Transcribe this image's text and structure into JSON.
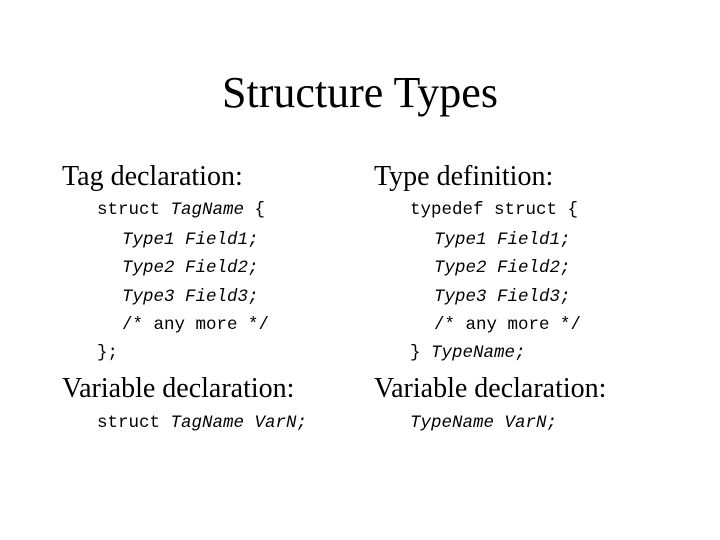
{
  "title": "Structure Types",
  "left": {
    "heading": "Tag declaration:",
    "code": {
      "line1_kw": "struct ",
      "line1_name": "TagName",
      "line1_end": " {",
      "field1": "Type1 Field1;",
      "field2": "Type2 Field2;",
      "field3": "Type3 Field3;",
      "comment": "/* any more */",
      "close": "};"
    },
    "var_heading": "Variable declaration:",
    "var_code": {
      "kw": "struct ",
      "tag": "TagName",
      "sep": " ",
      "var": "VarN;"
    }
  },
  "right": {
    "heading": "Type definition:",
    "code": {
      "line1": "typedef struct {",
      "field1": "Type1 Field1;",
      "field2": "Type2 Field2;",
      "field3": "Type3 Field3;",
      "comment": "/* any more */",
      "close_brace": "} ",
      "close_name": "TypeName;"
    },
    "var_heading": "Variable declaration:",
    "var_code": {
      "type": "TypeName",
      "sep": " ",
      "var": "VarN;"
    }
  }
}
